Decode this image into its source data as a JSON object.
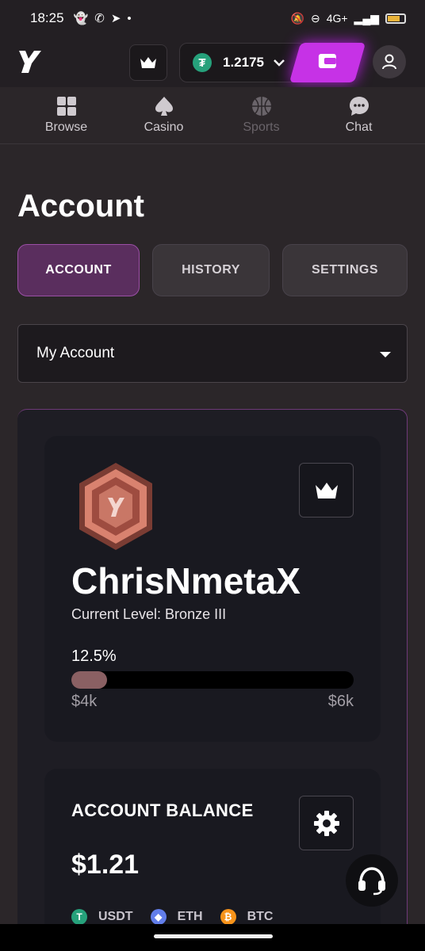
{
  "status_bar": {
    "time": "18:25",
    "network": "4G+"
  },
  "header": {
    "wallet_amount": "1.2175",
    "wallet_currency_icon": "tether-icon"
  },
  "nav": {
    "items": [
      {
        "label": "Browse",
        "icon": "grid-icon"
      },
      {
        "label": "Casino",
        "icon": "spade-icon"
      },
      {
        "label": "Sports",
        "icon": "basketball-icon"
      },
      {
        "label": "Chat",
        "icon": "chat-bubble-icon"
      }
    ]
  },
  "page": {
    "title": "Account",
    "tabs": [
      {
        "label": "ACCOUNT",
        "active": true
      },
      {
        "label": "HISTORY",
        "active": false
      },
      {
        "label": "SETTINGS",
        "active": false
      }
    ],
    "section_select": {
      "value": "My Account"
    }
  },
  "profile": {
    "username": "ChrisNmetaX",
    "current_level": "Current Level: Bronze III",
    "progress_label": "12.5%",
    "progress_fraction": 0.125,
    "range_low": "$4k",
    "range_high": "$6k"
  },
  "balance": {
    "title": "ACCOUNT BALANCE",
    "amount": "$1.21",
    "coins": [
      {
        "label": "USDT",
        "color": "#26a17b",
        "symbol": "T"
      },
      {
        "label": "ETH",
        "color": "#627eea",
        "symbol": "◆"
      },
      {
        "label": "BTC",
        "color": "#f7931a",
        "symbol": "₿"
      }
    ]
  },
  "colors": {
    "accent": "#c632e6",
    "tab_active_bg": "#5a2e5e",
    "progress_fill": "#8a6063"
  }
}
